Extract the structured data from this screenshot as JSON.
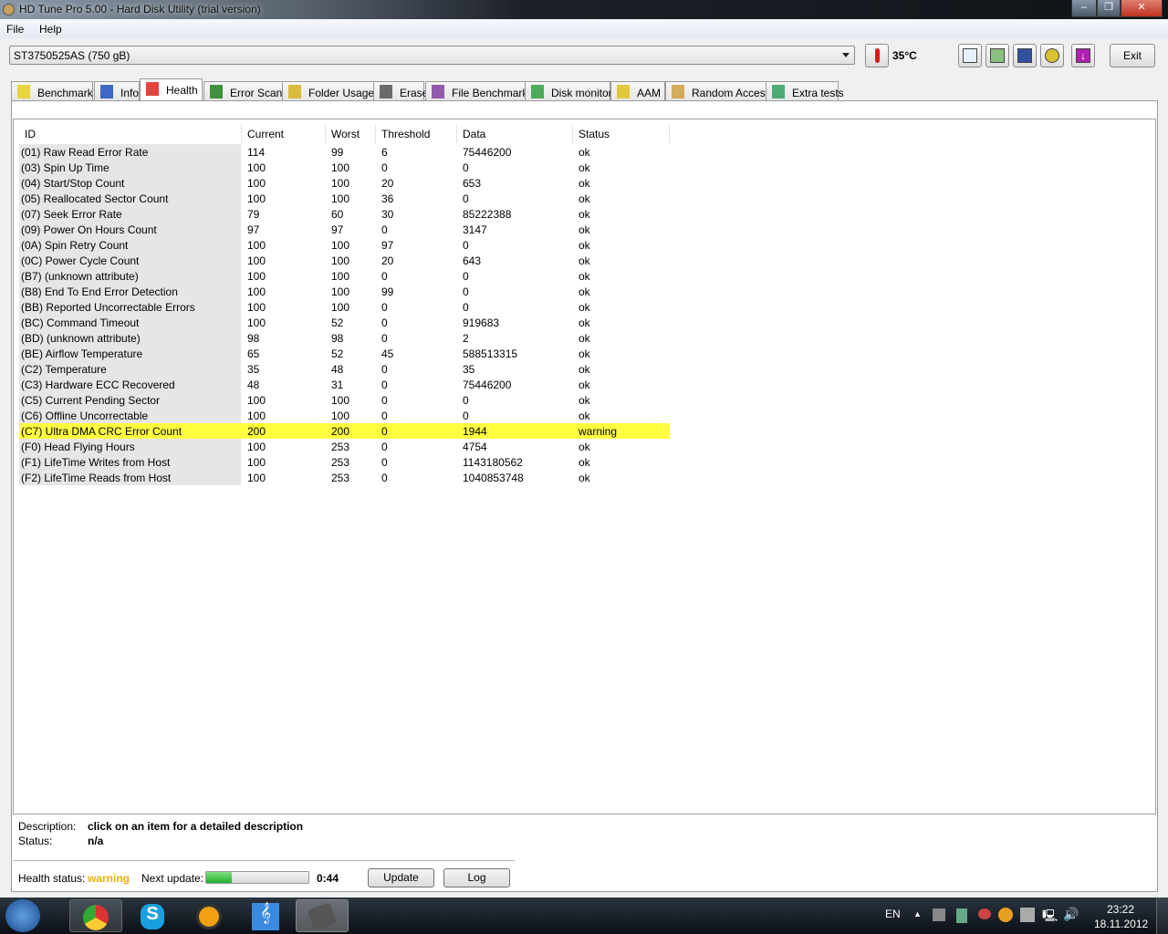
{
  "window": {
    "title": "HD Tune Pro 5.00 - Hard Disk Utility (trial version)"
  },
  "menu": [
    {
      "label": "File"
    },
    {
      "label": "Help"
    }
  ],
  "toolbar": {
    "drive": "ST3750525AS (750 gB)",
    "temperature": "35°C",
    "exit_label": "Exit",
    "icons": [
      "copy-text-icon",
      "copy-screenshot-icon",
      "save-icon",
      "options-icon",
      "download-icon"
    ]
  },
  "tabs": [
    {
      "label": "Benchmark",
      "icon": "lightbulb-icon"
    },
    {
      "label": "Info",
      "icon": "info-icon"
    },
    {
      "label": "Health",
      "icon": "red-cross-icon"
    },
    {
      "label": "Error Scan",
      "icon": "magnifier-icon"
    },
    {
      "label": "Folder Usage",
      "icon": "folder-icon"
    },
    {
      "label": "Erase",
      "icon": "trash-icon"
    },
    {
      "label": "File Benchmark",
      "icon": "file-benchmark-icon"
    },
    {
      "label": "Disk monitor",
      "icon": "chart-icon"
    },
    {
      "label": "AAM",
      "icon": "speaker-icon"
    },
    {
      "label": "Random Access",
      "icon": "scatter-icon"
    },
    {
      "label": "Extra tests",
      "icon": "calculator-icon"
    }
  ],
  "table": {
    "columns": [
      "ID",
      "Current",
      "Worst",
      "Threshold",
      "Data",
      "Status"
    ],
    "rows": [
      [
        "(01) Raw Read Error Rate",
        "114",
        "99",
        "6",
        "75446200",
        "ok"
      ],
      [
        "(03) Spin Up Time",
        "100",
        "100",
        "0",
        "0",
        "ok"
      ],
      [
        "(04) Start/Stop Count",
        "100",
        "100",
        "20",
        "653",
        "ok"
      ],
      [
        "(05) Reallocated Sector Count",
        "100",
        "100",
        "36",
        "0",
        "ok"
      ],
      [
        "(07) Seek Error Rate",
        "79",
        "60",
        "30",
        "85222388",
        "ok"
      ],
      [
        "(09) Power On Hours Count",
        "97",
        "97",
        "0",
        "3147",
        "ok"
      ],
      [
        "(0A) Spin Retry Count",
        "100",
        "100",
        "97",
        "0",
        "ok"
      ],
      [
        "(0C) Power Cycle Count",
        "100",
        "100",
        "20",
        "643",
        "ok"
      ],
      [
        "(B7) (unknown attribute)",
        "100",
        "100",
        "0",
        "0",
        "ok"
      ],
      [
        "(B8) End To End Error Detection",
        "100",
        "100",
        "99",
        "0",
        "ok"
      ],
      [
        "(BB) Reported Uncorrectable Errors",
        "100",
        "100",
        "0",
        "0",
        "ok"
      ],
      [
        "(BC) Command Timeout",
        "100",
        "52",
        "0",
        "919683",
        "ok"
      ],
      [
        "(BD) (unknown attribute)",
        "98",
        "98",
        "0",
        "2",
        "ok"
      ],
      [
        "(BE) Airflow Temperature",
        "65",
        "52",
        "45",
        "588513315",
        "ok"
      ],
      [
        "(C2) Temperature",
        "35",
        "48",
        "0",
        "35",
        "ok"
      ],
      [
        "(C3) Hardware ECC Recovered",
        "48",
        "31",
        "0",
        "75446200",
        "ok"
      ],
      [
        "(C5) Current Pending Sector",
        "100",
        "100",
        "0",
        "0",
        "ok"
      ],
      [
        "(C6) Offline Uncorrectable",
        "100",
        "100",
        "0",
        "0",
        "ok"
      ],
      [
        "(C7) Ultra DMA CRC Error Count",
        "200",
        "200",
        "0",
        "1944",
        "warning"
      ],
      [
        "(F0) Head Flying Hours",
        "100",
        "253",
        "0",
        "4754",
        "ok"
      ],
      [
        "(F1) LifeTime Writes from Host",
        "100",
        "253",
        "0",
        "1143180562",
        "ok"
      ],
      [
        "(F2) LifeTime Reads from Host",
        "100",
        "253",
        "0",
        "1040853748",
        "ok"
      ]
    ]
  },
  "details": {
    "description_label": "Description:",
    "description": "click on an item for a detailed description",
    "status_label": "Status:",
    "status": "n/a"
  },
  "footer": {
    "health_label": "Health status:",
    "health": "warning",
    "next_label": "Next update:",
    "progress": 0.25,
    "countdown": "0:44",
    "update_label": "Update",
    "log_label": "Log"
  },
  "colors": {
    "warning_row": "#ffff40",
    "warning_text": "#e8b400"
  },
  "taskbar": {
    "lang": "EN",
    "time": "23:22",
    "date": "18.11.2012",
    "apps": [
      "chrome-icon",
      "skype-icon",
      "aimp-icon",
      "music-icon",
      "hdtune-icon"
    ]
  }
}
